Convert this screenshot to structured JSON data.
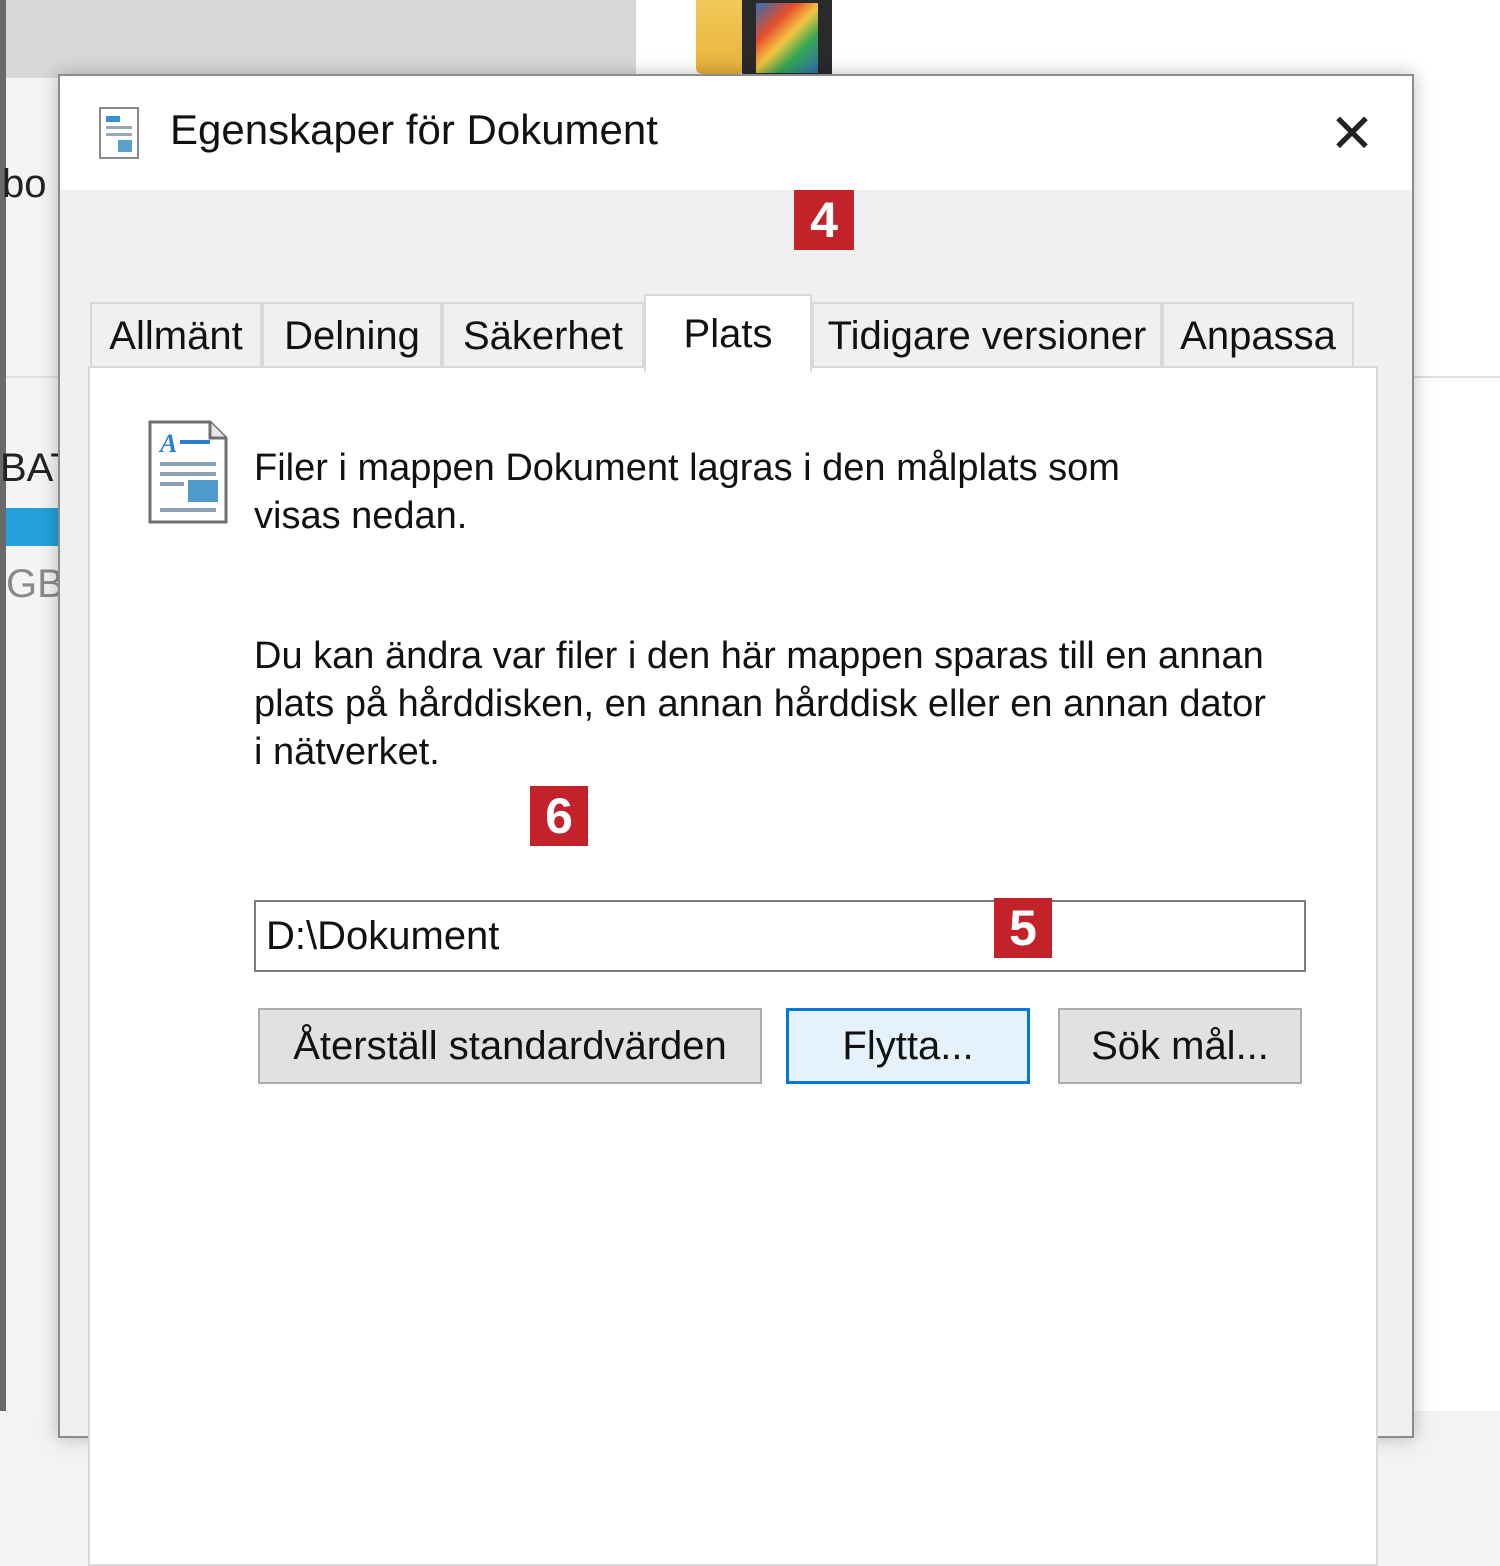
{
  "background": {
    "fragment_top": "bo",
    "fragment_mid": "BAT",
    "fragment_low": "GB"
  },
  "dialog": {
    "title": "Egenskaper för Dokument",
    "close_symbol": "✕",
    "tabs": [
      {
        "label": "Allmänt"
      },
      {
        "label": "Delning"
      },
      {
        "label": "Säkerhet"
      },
      {
        "label": "Plats"
      },
      {
        "label": "Tidigare versioner"
      },
      {
        "label": "Anpassa"
      }
    ],
    "active_tab": "Plats",
    "info_line1": "Filer i mappen Dokument lagras i den målplats som",
    "info_line2": "visas nedan.",
    "desc_line1": "Du kan ändra var filer i den här mappen sparas till en annan",
    "desc_line2": "plats på hårddisken, en annan hårddisk eller en annan dator",
    "desc_line3": "i nätverket.",
    "path_value": "D:\\Dokument",
    "buttons": {
      "restore": "Återställ standardvärden",
      "move": "Flytta...",
      "find": "Sök mål..."
    }
  },
  "badges": {
    "tab": "4",
    "move": "5",
    "path": "6"
  },
  "colors": {
    "badge": "#c3222a",
    "focus_border": "#0078d7",
    "selection_bar": "#26a0da"
  },
  "icons": {
    "title": "document-properties-icon",
    "content": "document-icon",
    "close": "close-icon"
  }
}
